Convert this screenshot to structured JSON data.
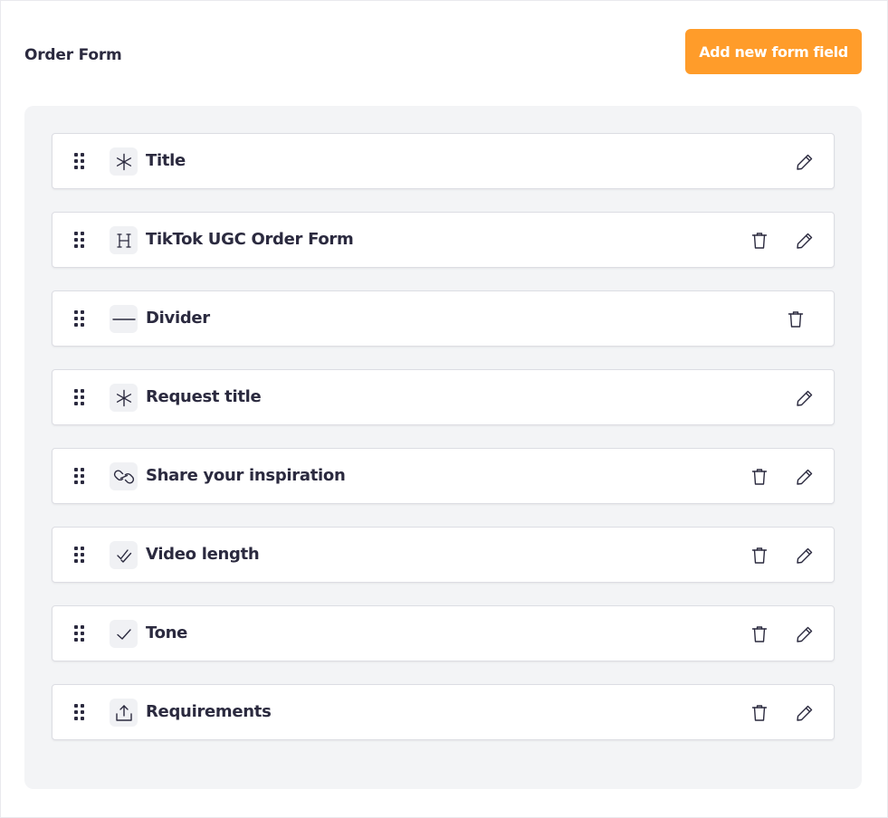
{
  "header": {
    "title": "Order Form",
    "add_button_label": "Add new form field"
  },
  "colors": {
    "accent": "#ff9c2a",
    "text": "#2b2a3f",
    "panel_bg": "#f3f4f6"
  },
  "fields": [
    {
      "label": "Title",
      "type_icon": "asterisk-icon",
      "deletable": false,
      "editable": true
    },
    {
      "label": "TikTok UGC Order Form",
      "type_icon": "heading-icon",
      "deletable": true,
      "editable": true
    },
    {
      "label": "Divider",
      "type_icon": "divider-line-icon",
      "deletable": true,
      "editable": false
    },
    {
      "label": "Request title",
      "type_icon": "asterisk-icon",
      "deletable": false,
      "editable": true
    },
    {
      "label": "Share your inspiration",
      "type_icon": "link-icon",
      "deletable": true,
      "editable": true
    },
    {
      "label": "Video length",
      "type_icon": "double-check-icon",
      "deletable": true,
      "editable": true
    },
    {
      "label": "Tone",
      "type_icon": "check-icon",
      "deletable": true,
      "editable": true
    },
    {
      "label": "Requirements",
      "type_icon": "upload-icon",
      "deletable": true,
      "editable": true
    }
  ]
}
